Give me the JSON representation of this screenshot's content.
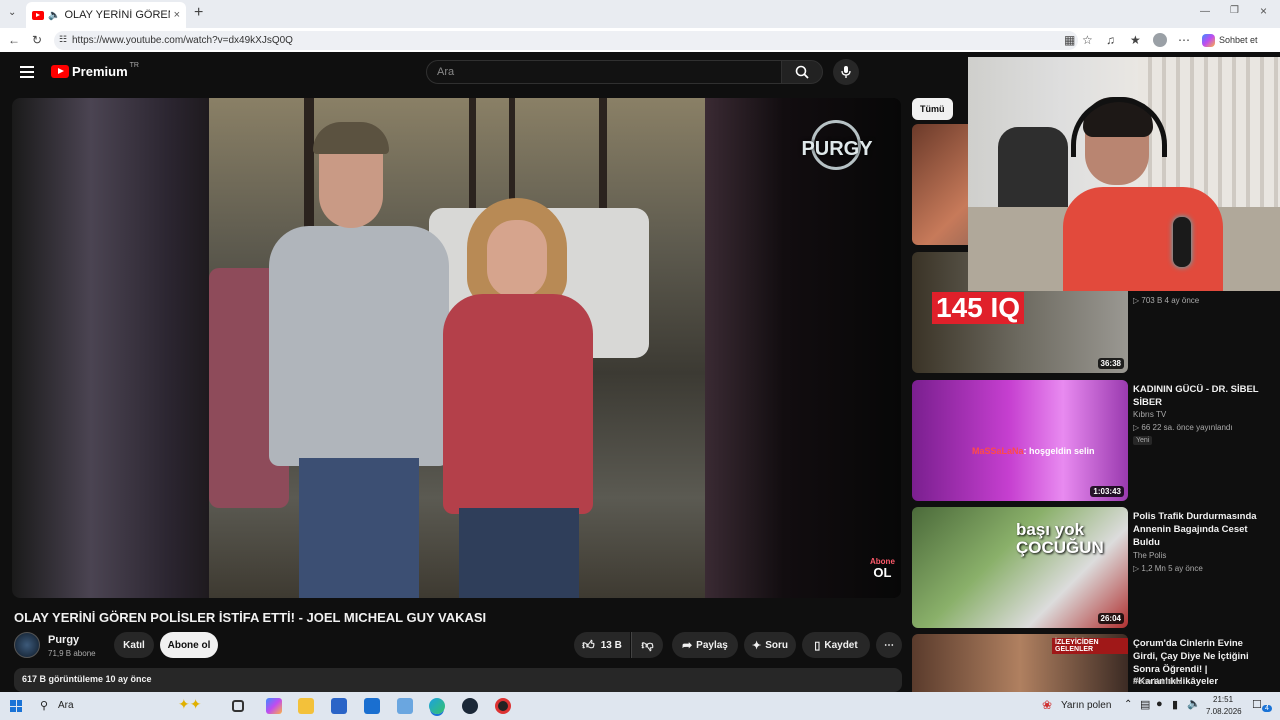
{
  "browser": {
    "tab_title": "OLAY YERİNİ GÖREN POLİSLE",
    "url": "https://www.youtube.com/watch?v=dx49kXJsQ0Q",
    "copilot_label": "Sohbet et"
  },
  "masthead": {
    "logo_text": "Premium",
    "region": "TR",
    "search_placeholder": "Ara"
  },
  "video": {
    "watermark": "PURGY",
    "overlay_top": "Abone",
    "overlay_bottom": "OL",
    "title": "OLAY YERİNİ GÖREN POLİSLER İSTİFA ETTİ! - JOEL MICHEAL GUY VAKASI",
    "channel": "Purgy",
    "subscribers": "71,9 B abone",
    "join_label": "Katıl",
    "subscribe_label": "Abone ol",
    "likes": "13 B",
    "share_label": "Paylaş",
    "ask_label": "Soru",
    "save_label": "Kaydet",
    "views_date": "617 B görüntüleme  10 ay önce"
  },
  "chips": {
    "all": "Tümü"
  },
  "recommendations": [
    {
      "title": "",
      "channel": "",
      "meta": "703 B   4 ay önce",
      "duration": "36:38",
      "thumb_text": "145 IQ"
    },
    {
      "title": "KADININ GÜCÜ - DR. SİBEL SİBER",
      "channel": "Kıbrıs TV",
      "meta": "66   22 sa. önce yayınlandı",
      "badge": "Yeni",
      "duration": "1:03:43",
      "chat_user": "MaSSaLaNa",
      "chat_text": ": hoşgeldin selin"
    },
    {
      "title": "Polis Trafik Durdurmasında Annenin Bagajında Ceset Buldu",
      "channel": "The Polis",
      "meta": "1,2 Mn   5 ay önce",
      "duration": "26:04",
      "thumb_text": "başı yok ÇOCUĞUN"
    },
    {
      "title": "Çorum'da Cinlerin Evine Girdi, Çay Diye Ne İçtiğini Sonra Öğrendi! | #KaranlıkHikâyeler",
      "channel": "Foon Kriminal",
      "meta": "",
      "duration": "",
      "thumb_text": "İZLEYİCİDEN GELENLER"
    }
  ],
  "taskbar": {
    "search": "Ara",
    "weather": "Yarın polen",
    "time": "21:51",
    "date": "7.08.2026",
    "notifications": "4"
  }
}
